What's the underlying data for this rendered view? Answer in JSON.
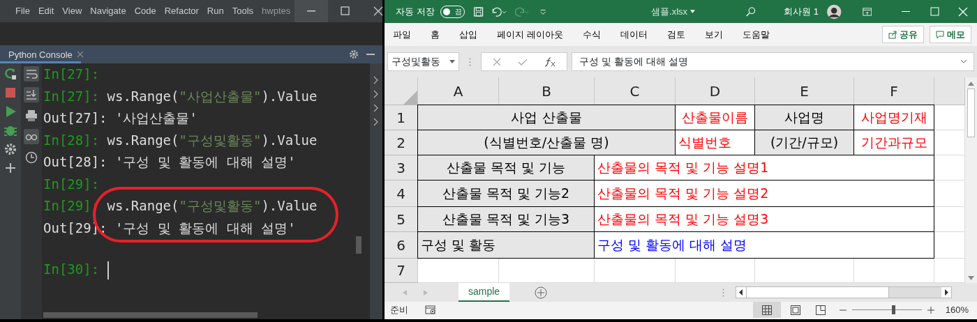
{
  "ide": {
    "menu": [
      "File",
      "Edit",
      "View",
      "Navigate",
      "Code",
      "Refactor",
      "Run",
      "Tools",
      "hwptes"
    ],
    "tool_tab": {
      "label": "Python Console",
      "selected": true
    },
    "console": [
      {
        "kind": "prompt",
        "prompt": "In[27]:"
      },
      {
        "kind": "input",
        "prompt": "In[27]:",
        "parts": [
          {
            "kind": "code",
            "text": "ws.Range("
          },
          {
            "kind": "string",
            "text": "\"사업산출물\""
          },
          {
            "kind": "code",
            "text": ").Value"
          }
        ]
      },
      {
        "kind": "output",
        "prompt": "Out[27]:",
        "parts": [
          {
            "kind": "code",
            "text": "'사업산출물'"
          }
        ]
      },
      {
        "kind": "input",
        "prompt": "In[28]:",
        "parts": [
          {
            "kind": "code",
            "text": "ws.Range("
          },
          {
            "kind": "string",
            "text": "\"구성및활동\""
          },
          {
            "kind": "code",
            "text": ").Value"
          }
        ]
      },
      {
        "kind": "output",
        "prompt": "Out[28]:",
        "parts": [
          {
            "kind": "code",
            "text": "'구성 및 활동에 대해 설명'"
          }
        ]
      },
      {
        "kind": "prompt",
        "prompt": "In[29]:"
      },
      {
        "kind": "input",
        "prompt": "In[29]:",
        "parts": [
          {
            "kind": "code",
            "text": "ws.Range("
          },
          {
            "kind": "string",
            "text": "\"구성및활동\""
          },
          {
            "kind": "code",
            "text": ").Value"
          }
        ]
      },
      {
        "kind": "output",
        "prompt": "Out[29]:",
        "parts": [
          {
            "kind": "code",
            "text": "'구성 및 활동에 대해 설명'"
          }
        ]
      },
      {
        "kind": "current",
        "prompt": "In[30]:"
      }
    ]
  },
  "excel": {
    "autosave_label": "자동 저장",
    "autosave": {
      "on": false,
      "label": "끔"
    },
    "file_name": "샘플.xlsx",
    "user": "회사원 1",
    "ribbon_tabs": [
      "파일",
      "홈",
      "삽입",
      "페이지 레이아웃",
      "수식",
      "데이터",
      "검토",
      "보기",
      "도움말"
    ],
    "share_button": "공유",
    "comment_button": "메모",
    "name_box": "구성및활동",
    "formula": "구성 및 활동에 대해 설명",
    "columns": [
      "A",
      "B",
      "C",
      "D",
      "E",
      "F"
    ],
    "rows": [
      {
        "header": "1",
        "cells": [
          {
            "text": "사업 산출물",
            "shaded": true,
            "left_aligned": false,
            "color": "#000000"
          },
          {
            "merged": true
          },
          {
            "merged": true
          },
          {
            "text": "산출물이름",
            "shaded": false,
            "left_aligned": false,
            "color": "#ff0000"
          },
          {
            "text": "사업명",
            "shaded": true,
            "left_aligned": false,
            "color": "#000000"
          },
          {
            "text": "사업명기재",
            "shaded": false,
            "left_aligned": false,
            "color": "#ff0000"
          }
        ]
      },
      {
        "header": "2",
        "cells": [
          {
            "text": "(식별번호/산출물 명)",
            "shaded": true,
            "left_aligned": false,
            "color": "#000000"
          },
          {
            "merged": true
          },
          {
            "merged": true
          },
          {
            "text": "식별번호",
            "shaded": false,
            "left_aligned": true,
            "color": "#ff0000"
          },
          {
            "text": "(기간/규모)",
            "shaded": true,
            "left_aligned": false,
            "color": "#000000"
          },
          {
            "text": "기간과규모",
            "shaded": false,
            "left_aligned": false,
            "color": "#ff0000"
          }
        ]
      },
      {
        "header": "3",
        "cells": [
          {
            "text": "산출물 목적 및 기능",
            "shaded": true,
            "left_aligned": false,
            "color": "#000000"
          },
          {
            "merged": true
          },
          {
            "text": "산출물의 목적 및 기능 설명1",
            "shaded": false,
            "left_aligned": true,
            "color": "#ff0000"
          },
          {
            "merged": true
          },
          {
            "merged": true
          },
          {
            "merged": true
          }
        ]
      },
      {
        "header": "4",
        "cells": [
          {
            "text": "산출물 목적 및 기능2",
            "shaded": true,
            "left_aligned": false,
            "color": "#000000"
          },
          {
            "merged": true
          },
          {
            "text": "산출물의 목적 및 기능 설명2",
            "shaded": false,
            "left_aligned": true,
            "color": "#ff0000"
          },
          {
            "merged": true
          },
          {
            "merged": true
          },
          {
            "merged": true
          }
        ]
      },
      {
        "header": "5",
        "cells": [
          {
            "text": "산출물 목적 및 기능3",
            "shaded": true,
            "left_aligned": false,
            "color": "#000000"
          },
          {
            "merged": true
          },
          {
            "text": "산출물의 목적 및 기능 설명3",
            "shaded": false,
            "left_aligned": true,
            "color": "#ff0000"
          },
          {
            "merged": true
          },
          {
            "merged": true
          },
          {
            "merged": true
          }
        ]
      },
      {
        "header": "6",
        "cells": [
          {
            "text": "구성 및 활동",
            "shaded": true,
            "left_aligned": true,
            "color": "#000000"
          },
          {
            "merged": true
          },
          {
            "text": "구성 및 활동에 대해 설명",
            "shaded": false,
            "left_aligned": true,
            "color": "#0000ff"
          },
          {
            "merged": true
          },
          {
            "merged": true
          },
          {
            "merged": true
          }
        ]
      },
      {
        "header": "7",
        "cells": [
          {
            "merged": false
          },
          {
            "merged": false
          },
          {
            "merged": false
          },
          {
            "merged": false
          },
          {
            "merged": false
          },
          {
            "merged": false
          }
        ]
      }
    ],
    "sheet_tabs": [
      {
        "label": "sample",
        "selected": true
      }
    ],
    "status": "준비",
    "zoom": {
      "level": 0.6,
      "reading": "160%"
    }
  }
}
